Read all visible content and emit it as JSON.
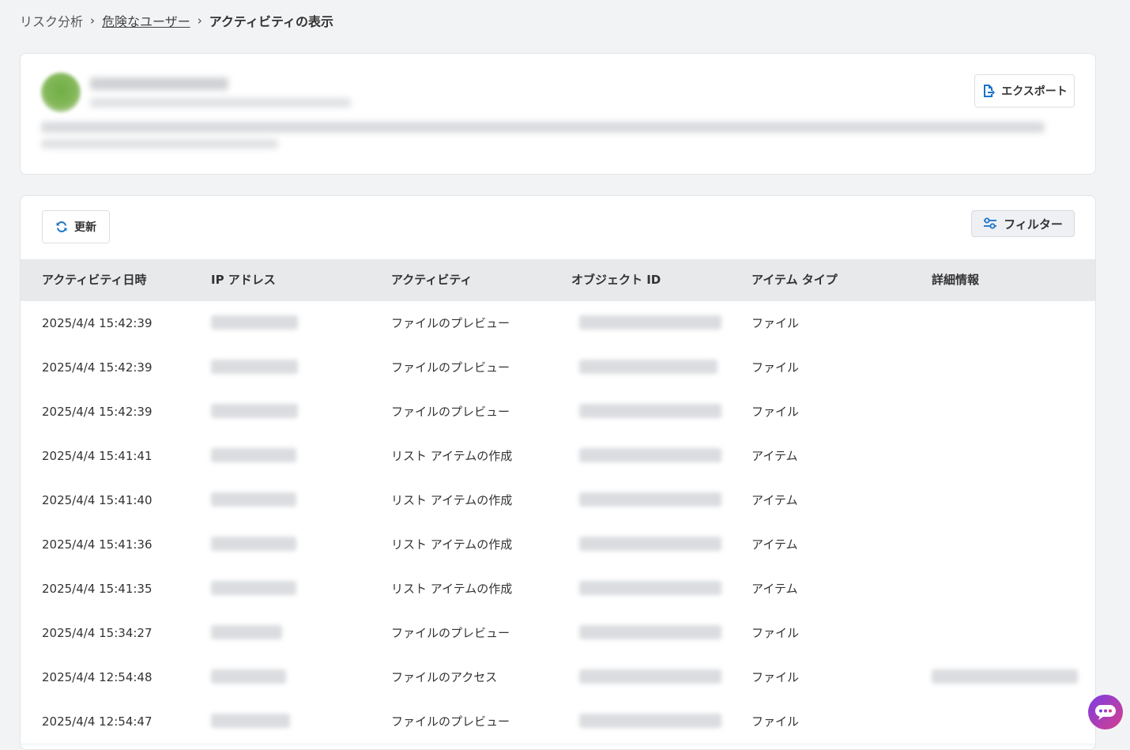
{
  "breadcrumb": {
    "root": "リスク分析",
    "parent": "危険なユーザー",
    "current": "アクティビティの表示"
  },
  "user_card": {
    "export_label": "エクスポート"
  },
  "toolbar": {
    "refresh_label": "更新",
    "filter_label": "フィルター"
  },
  "table": {
    "columns": [
      "アクティビティ日時",
      "IP アドレス",
      "アクティビティ",
      "オブジェクト ID",
      "アイテム タイプ",
      "詳細情報"
    ],
    "rows": [
      {
        "datetime": "2025/4/4 15:42:39",
        "activity": "ファイルのプレビュー",
        "item_type": "ファイル"
      },
      {
        "datetime": "2025/4/4 15:42:39",
        "activity": "ファイルのプレビュー",
        "item_type": "ファイル"
      },
      {
        "datetime": "2025/4/4 15:42:39",
        "activity": "ファイルのプレビュー",
        "item_type": "ファイル"
      },
      {
        "datetime": "2025/4/4 15:41:41",
        "activity": "リスト アイテムの作成",
        "item_type": "アイテム"
      },
      {
        "datetime": "2025/4/4 15:41:40",
        "activity": "リスト アイテムの作成",
        "item_type": "アイテム"
      },
      {
        "datetime": "2025/4/4 15:41:36",
        "activity": "リスト アイテムの作成",
        "item_type": "アイテム"
      },
      {
        "datetime": "2025/4/4 15:41:35",
        "activity": "リスト アイテムの作成",
        "item_type": "アイテム"
      },
      {
        "datetime": "2025/4/4 15:34:27",
        "activity": "ファイルのプレビュー",
        "item_type": "ファイル"
      },
      {
        "datetime": "2025/4/4 12:54:48",
        "activity": "ファイルのアクセス",
        "item_type": "ファイル"
      },
      {
        "datetime": "2025/4/4 12:54:47",
        "activity": "ファイルのプレビュー",
        "item_type": "ファイル"
      }
    ]
  },
  "colors": {
    "accent": "#1a73c8",
    "chat_gradient_start": "#7b3fe4",
    "chat_gradient_end": "#d63d8c"
  },
  "icons": {
    "chevron": "chevron-right-icon",
    "export": "export-file-icon",
    "refresh": "refresh-icon",
    "filter": "filter-sliders-icon",
    "chat": "chat-bot-icon"
  }
}
